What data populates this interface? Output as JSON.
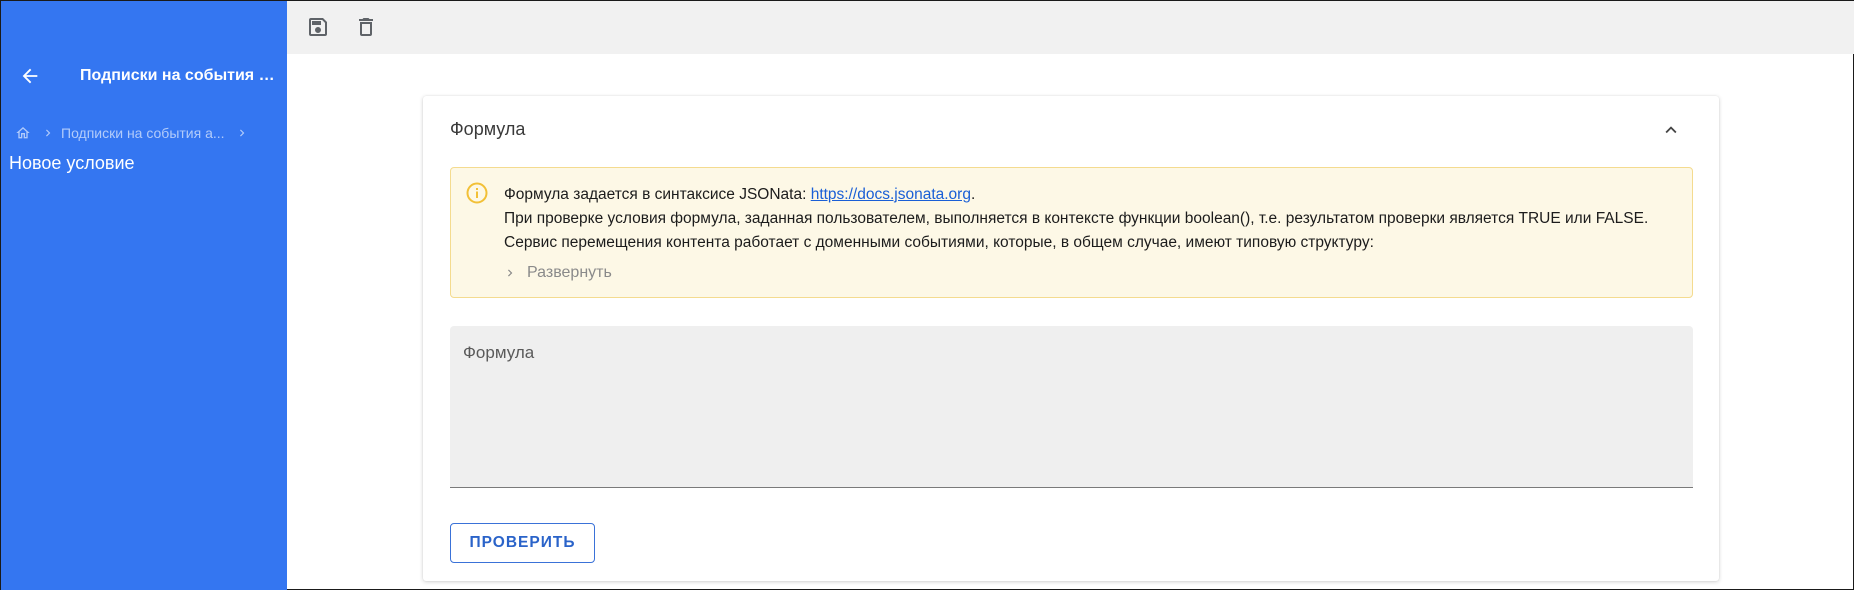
{
  "sidebar": {
    "title": "Подписки на события а...",
    "breadcrumb": {
      "item": "Подписки на события а..."
    },
    "page_title": "Новое условие"
  },
  "toolbar": {
    "save_icon": "save-icon",
    "delete_icon": "trash-icon"
  },
  "card": {
    "title": "Формула",
    "alert": {
      "line1_text": "Формула задается в синтаксисе JSONata: ",
      "line1_link": "https://docs.jsonata.org",
      "line1_end": ".",
      "line2": "При проверке условия формула, заданная пользователем, выполняется в контексте функции boolean(), т.е. результатом проверки является TRUE или FALSE.",
      "line3": "Сервис перемещения контента работает с доменными событиями, которые, в общем случае, имеют типовую структуру:",
      "expand_label": "Развернуть"
    },
    "formula_field": {
      "label": "Формула",
      "value": ""
    },
    "check_button": "ПРОВЕРИТЬ"
  },
  "colors": {
    "sidebar": "#3476f1",
    "toolbar": "#f1f1f1",
    "alert_bg": "#fdf8e6",
    "alert_border": "#f4db8f",
    "accent": "#2a63c9"
  }
}
